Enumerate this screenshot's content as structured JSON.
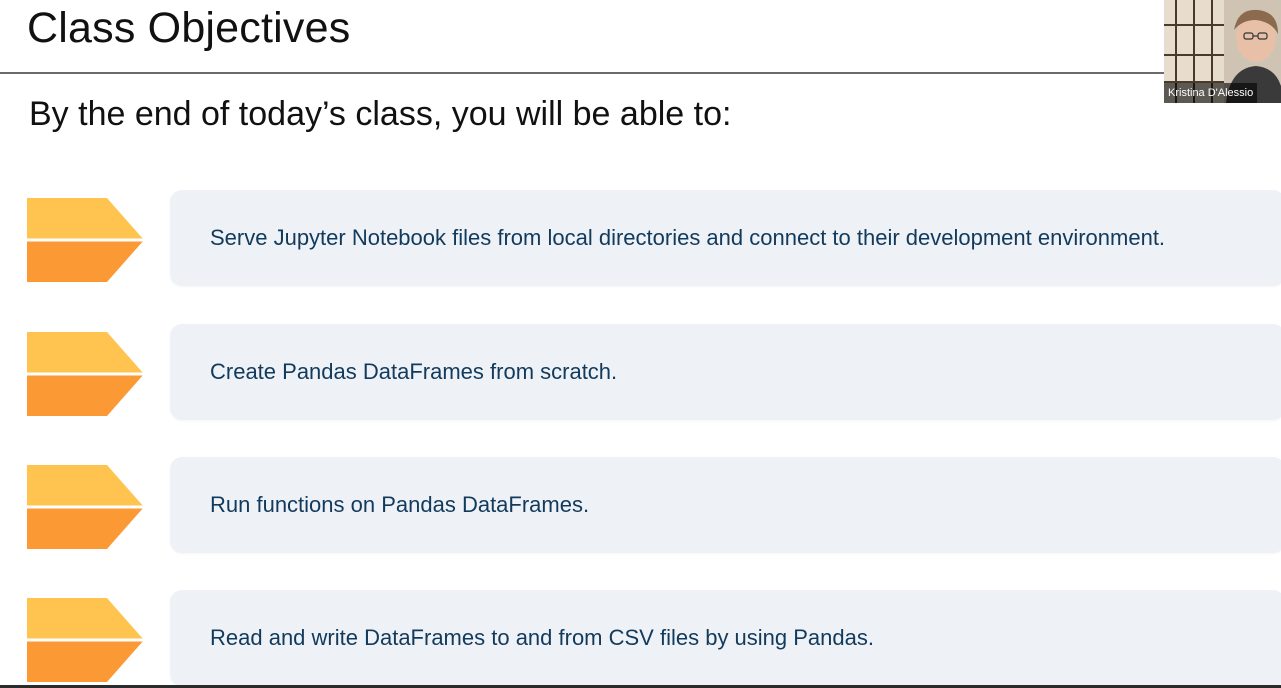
{
  "slide": {
    "title": "Class Objectives",
    "subtitle": "By the end of today’s class, you will be able to:",
    "colors": {
      "chevron_top": "#fec44f",
      "chevron_bottom": "#fb9a35",
      "card_bg": "#eef2f6",
      "card_text": "#123a5c"
    },
    "objectives": [
      {
        "text": "Serve Jupyter Notebook files from local directories and connect to their development environment."
      },
      {
        "text": "Create Pandas DataFrames from scratch."
      },
      {
        "text": "Run functions on Pandas DataFrames."
      },
      {
        "text": "Read and write DataFrames to and from CSV files by using Pandas."
      }
    ]
  },
  "webcam": {
    "participant_name": "Kristina D'Alessio"
  }
}
